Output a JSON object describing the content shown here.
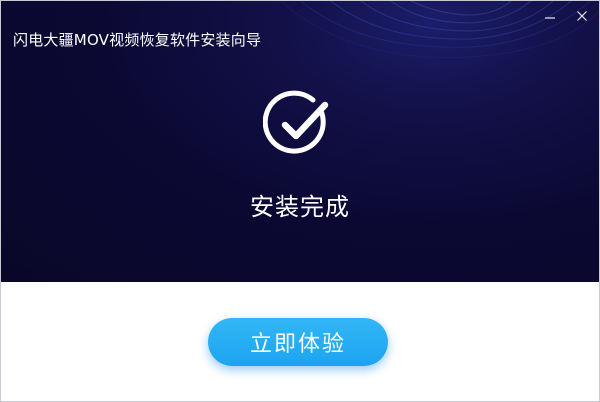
{
  "window": {
    "title": "闪电大疆MOV视频恢复软件安装向导",
    "minimize_icon": "minimize-icon",
    "close_icon": "close-icon"
  },
  "status": {
    "icon": "check-circle-icon",
    "text": "安装完成"
  },
  "footer": {
    "primary_button_label": "立即体验"
  },
  "colors": {
    "hero_background": "#0b0933",
    "button_accent": "#1ba4ef",
    "text_on_dark": "#ffffff"
  }
}
